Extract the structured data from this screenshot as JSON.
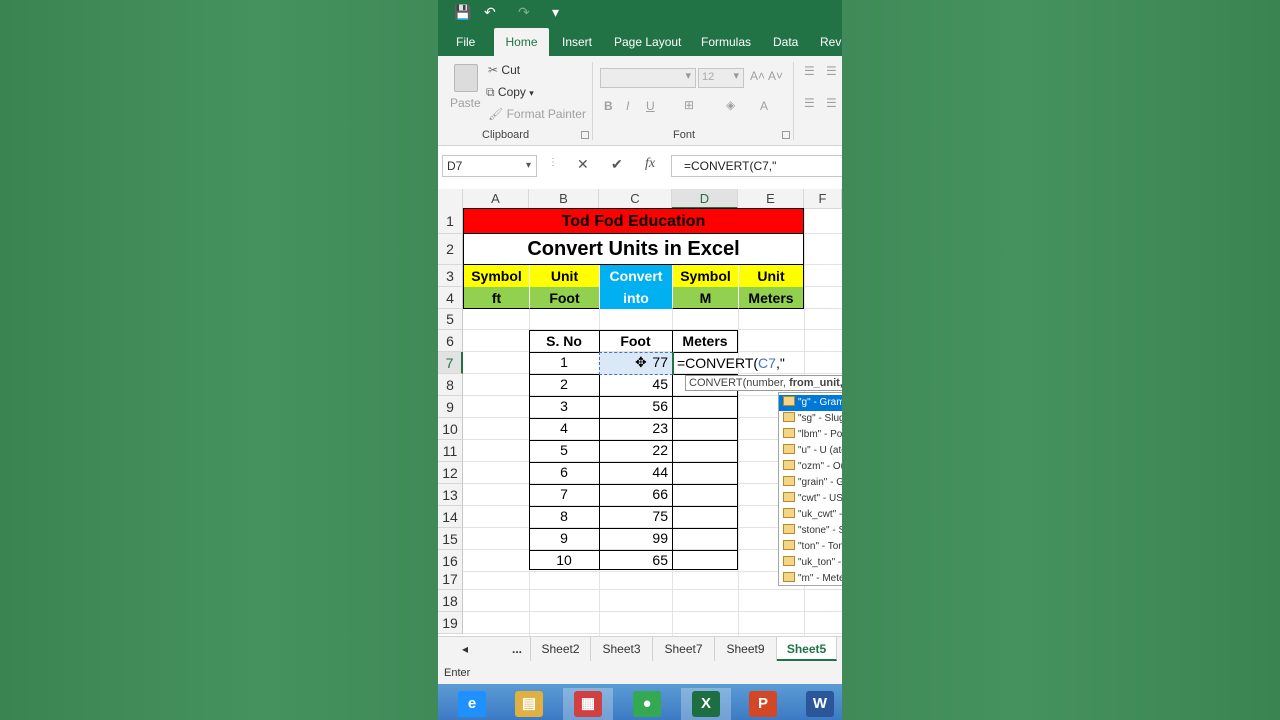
{
  "quick_access": {
    "save": "💾",
    "undo": "↶",
    "redo": "↷",
    "more": "▾"
  },
  "ribbon_tabs": [
    {
      "label": "File"
    },
    {
      "label": "Home"
    },
    {
      "label": "Insert"
    },
    {
      "label": "Page Layout"
    },
    {
      "label": "Formulas"
    },
    {
      "label": "Data"
    },
    {
      "label": "Revi"
    }
  ],
  "clipboard": {
    "paste": "Paste",
    "cut": "Cut",
    "copy": "Copy",
    "format_painter": "Format Painter",
    "group": "Clipboard"
  },
  "font": {
    "size": "12",
    "grow": "A˄",
    "shrink": "A˅",
    "bold": "B",
    "italic": "I",
    "underline": "U",
    "color_a": "A",
    "group": "Font"
  },
  "formula_bar": {
    "name_box": "D7",
    "cancel": "✕",
    "enter": "✔",
    "fx": "fx",
    "formula": "=CONVERT(C7,\""
  },
  "columns": [
    "A",
    "B",
    "C",
    "D",
    "E",
    "F"
  ],
  "rows": [
    "1",
    "2",
    "3",
    "4",
    "5",
    "6",
    "7",
    "8",
    "9",
    "10",
    "11",
    "12",
    "13",
    "14",
    "15",
    "16",
    "17",
    "18",
    "19"
  ],
  "sheet": {
    "title": "Tod Fod Education",
    "subtitle": "Convert Units in Excel",
    "row3": [
      "Symbol",
      "Unit",
      "Convert",
      "Symbol",
      "Unit"
    ],
    "row4": [
      "ft",
      "Foot",
      "into",
      "M",
      "Meters"
    ],
    "table_headers": [
      "S. No",
      "Foot",
      "Meters"
    ],
    "table_rows": [
      {
        "sno": "1",
        "foot": "77"
      },
      {
        "sno": "2",
        "foot": "45"
      },
      {
        "sno": "3",
        "foot": "56"
      },
      {
        "sno": "4",
        "foot": "23"
      },
      {
        "sno": "5",
        "foot": "22"
      },
      {
        "sno": "6",
        "foot": "44"
      },
      {
        "sno": "7",
        "foot": "66"
      },
      {
        "sno": "8",
        "foot": "75"
      },
      {
        "sno": "9",
        "foot": "99"
      },
      {
        "sno": "10",
        "foot": "65"
      }
    ],
    "editing_prefix": "=CONVERT(",
    "editing_ref": "C7",
    "editing_suffix": ",\""
  },
  "tooltip": {
    "fn": "CONVERT(number, ",
    "arg": "from_unit,"
  },
  "autocomplete": [
    {
      "label": "\"g\" - Gram"
    },
    {
      "label": "\"sg\" - Slug"
    },
    {
      "label": "\"lbm\" - Pound"
    },
    {
      "label": "\"u\" - U (atomic)"
    },
    {
      "label": "\"ozm\" - Ounce"
    },
    {
      "label": "\"grain\" - Grain"
    },
    {
      "label": "\"cwt\" - US hundredweight"
    },
    {
      "label": "\"uk_cwt\" - Imperial"
    },
    {
      "label": "\"stone\" - Stone"
    },
    {
      "label": "\"ton\" - Ton"
    },
    {
      "label": "\"uk_ton\" - Imperial ton"
    },
    {
      "label": "\"m\" - Meter"
    }
  ],
  "sheet_tabs": [
    {
      "label": "◂"
    },
    {
      "label": "..."
    },
    {
      "label": "Sheet2"
    },
    {
      "label": "Sheet3"
    },
    {
      "label": "Sheet7"
    },
    {
      "label": "Sheet9"
    },
    {
      "label": "Sheet5"
    }
  ],
  "status": "Enter",
  "taskbar": [
    {
      "name": "ie",
      "glyph": "e",
      "color": "#1e90ff"
    },
    {
      "name": "explorer",
      "glyph": "▤",
      "color": "#e0b040"
    },
    {
      "name": "store",
      "glyph": "▦",
      "color": "#d04040"
    },
    {
      "name": "chrome",
      "glyph": "●",
      "color": "#34a853"
    },
    {
      "name": "excel",
      "glyph": "X",
      "color": "#1d6f42"
    },
    {
      "name": "powerpoint",
      "glyph": "P",
      "color": "#d24726"
    },
    {
      "name": "word",
      "glyph": "W",
      "color": "#2b579a"
    }
  ],
  "colors": {
    "title_red": "#ff0000",
    "row3_yellow": "#ffff00",
    "convert_blue": "#00b0f0",
    "row4_green": "#92d050",
    "excel_green": "#217346"
  }
}
